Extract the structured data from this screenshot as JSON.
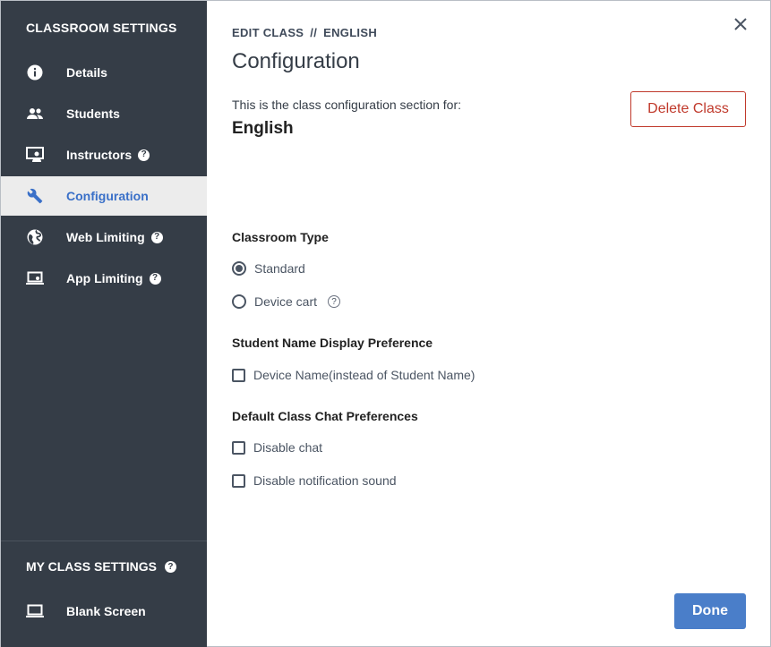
{
  "sidebar": {
    "title": "CLASSROOM SETTINGS",
    "items": [
      {
        "label": "Details",
        "icon": "info-icon"
      },
      {
        "label": "Students",
        "icon": "people-icon"
      },
      {
        "label": "Instructors",
        "icon": "presenter-icon",
        "help": "?"
      },
      {
        "label": "Configuration",
        "icon": "wrench-icon",
        "active": true
      },
      {
        "label": "Web Limiting",
        "icon": "globe-icon",
        "help": "?"
      },
      {
        "label": "App Limiting",
        "icon": "laptop-gear-icon",
        "help": "?"
      }
    ],
    "my_settings": {
      "title": "MY CLASS SETTINGS",
      "help": "?",
      "items": [
        {
          "label": "Blank Screen",
          "icon": "laptop-icon"
        }
      ]
    }
  },
  "header": {
    "crumb_edit": "EDIT CLASS",
    "crumb_sep": "//",
    "crumb_class": "ENGLISH",
    "title": "Configuration"
  },
  "intro": {
    "text": "This is the class configuration section for:",
    "class_name": "English"
  },
  "delete_label": "Delete Class",
  "classroom_type": {
    "heading": "Classroom Type",
    "options": [
      {
        "label": "Standard",
        "selected": true
      },
      {
        "label": "Device cart",
        "selected": false,
        "help": "?"
      }
    ]
  },
  "name_display": {
    "heading": "Student Name Display Preference",
    "option": {
      "label": "Device Name(instead of Student Name)",
      "checked": false
    }
  },
  "chat": {
    "heading": "Default Class Chat Preferences",
    "options": [
      {
        "label": "Disable chat",
        "checked": false
      },
      {
        "label": "Disable notification sound",
        "checked": false
      }
    ]
  },
  "done_label": "Done",
  "colors": {
    "sidebar_bg": "#353d47",
    "active_bg": "#ececec",
    "accent": "#3a70c8",
    "danger": "#c0392b",
    "primary_button": "#4a7ec9"
  }
}
